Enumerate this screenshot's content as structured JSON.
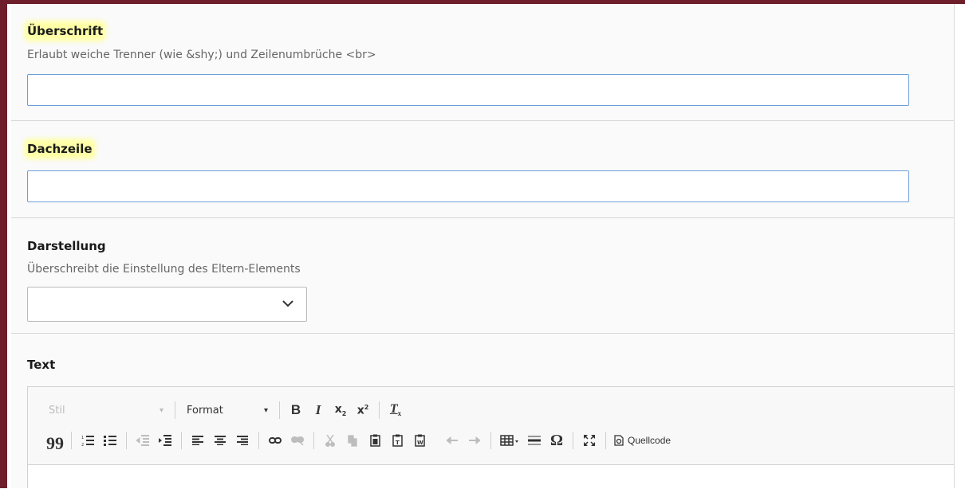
{
  "fields": {
    "headline": {
      "label": "Überschrift",
      "description": "Erlaubt weiche Trenner (wie &shy;) und Zeilenumbrüche <br>",
      "value": ""
    },
    "subheadline": {
      "label": "Dachzeile",
      "value": ""
    },
    "display": {
      "label": "Darstellung",
      "description": "Überschreibt die Einstellung des Eltern-Elements",
      "selected": ""
    },
    "text": {
      "label": "Text"
    }
  },
  "editor": {
    "style_combo": "Stil",
    "format_combo": "Format",
    "source_button": "Quellcode"
  },
  "colors": {
    "frame": "#6f1f2c",
    "highlight": "#ffffa8",
    "input_border": "#6d9ed9"
  }
}
